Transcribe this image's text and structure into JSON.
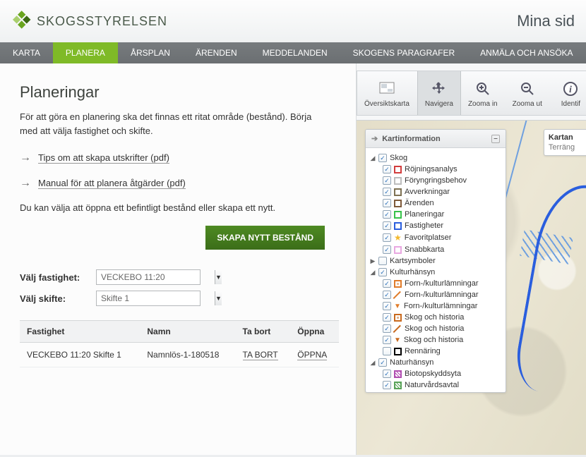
{
  "brand": {
    "name": "SKOGSSTYRELSEN"
  },
  "header": {
    "right": "Mina sid"
  },
  "nav": {
    "items": [
      {
        "label": "KARTA"
      },
      {
        "label": "PLANERA"
      },
      {
        "label": "ÅRSPLAN"
      },
      {
        "label": "ÄRENDEN"
      },
      {
        "label": "MEDDELANDEN"
      },
      {
        "label": "SKOGENS PARAGRAFER"
      },
      {
        "label": "ANMÄLA OCH ANSÖKA"
      }
    ],
    "active_index": 1
  },
  "page": {
    "title": "Planeringar",
    "intro": "För att göra en planering ska det finnas ett ritat område (bestånd). Börja med att välja fastighet och skifte.",
    "link1": "Tips om att skapa utskrifter (pdf)",
    "link2": "Manual för att planera åtgärder (pdf)",
    "body": "Du kan välja att öppna ett befintligt bestånd eller skapa ett nytt.",
    "create_btn": "SKAPA NYTT BESTÅND",
    "label_fastighet": "Välj fastighet:",
    "label_skifte": "Välj skifte:",
    "select_fastighet": "VECKEBO 11:20",
    "select_skifte": "Skifte 1"
  },
  "table": {
    "headers": {
      "fastighet": "Fastighet",
      "namn": "Namn",
      "tabort": "Ta bort",
      "oppna": "Öppna"
    },
    "rows": [
      {
        "fastighet": "VECKEBO 11:20 Skifte 1",
        "namn": "Namnlös-1-180518",
        "tabort": "TA BORT",
        "oppna": "ÖPPNA"
      }
    ]
  },
  "tools": {
    "overview": "Översiktskarta",
    "navigate": "Navigera",
    "zoom_in": "Zooma in",
    "zoom_out": "Zooma ut",
    "identify": "Identif"
  },
  "panel": {
    "title": "Kartinformation",
    "side": {
      "kartan": "Kartan",
      "terrang": "Terräng"
    },
    "groups": {
      "skog": {
        "label": "Skog",
        "items": [
          {
            "label": "Röjningsanalys",
            "color": "#d23d3d"
          },
          {
            "label": "Föryngringsbehov",
            "color": "#bdbdbd"
          },
          {
            "label": "Avverkningar",
            "color": "#7e7153"
          },
          {
            "label": "Ärenden",
            "color": "#7e5a3a"
          },
          {
            "label": "Planeringar",
            "color": "#37c24a"
          },
          {
            "label": "Fastigheter",
            "color": "#2a5ede"
          },
          {
            "label": "Favoritplatser",
            "icon": "star",
            "color": "#f3b92d"
          },
          {
            "label": "Snabbkarta",
            "color": "#e9a8e1"
          }
        ]
      },
      "kartsymboler": {
        "label": "Kartsymboler"
      },
      "kulturhansyn": {
        "label": "Kulturhänsyn",
        "items": [
          {
            "label": "Forn-/kulturlämningar",
            "icon": "sq-dot",
            "color": "#e07c2a"
          },
          {
            "label": "Forn-/kulturlämningar",
            "icon": "slash-up",
            "color": "#e07c2a"
          },
          {
            "label": "Forn-/kulturlämningar",
            "icon": "tri-down",
            "color": "#e07c2a"
          },
          {
            "label": "Skog och historia",
            "icon": "sq-dot",
            "color": "#c96a1f"
          },
          {
            "label": "Skog och historia",
            "icon": "slash-up",
            "color": "#c96a1f"
          },
          {
            "label": "Skog och historia",
            "icon": "tri-down",
            "color": "#c96a1f"
          },
          {
            "label": "Rennäring",
            "color": "#000000",
            "unchecked": true
          }
        ]
      },
      "naturhansyn": {
        "label": "Naturhänsyn",
        "items": [
          {
            "label": "Biotopskyddsyta",
            "icon": "hatch",
            "color": "#b14fb1"
          },
          {
            "label": "Naturvårdsavtal",
            "icon": "hatch",
            "color": "#5aa35a"
          }
        ]
      }
    }
  }
}
